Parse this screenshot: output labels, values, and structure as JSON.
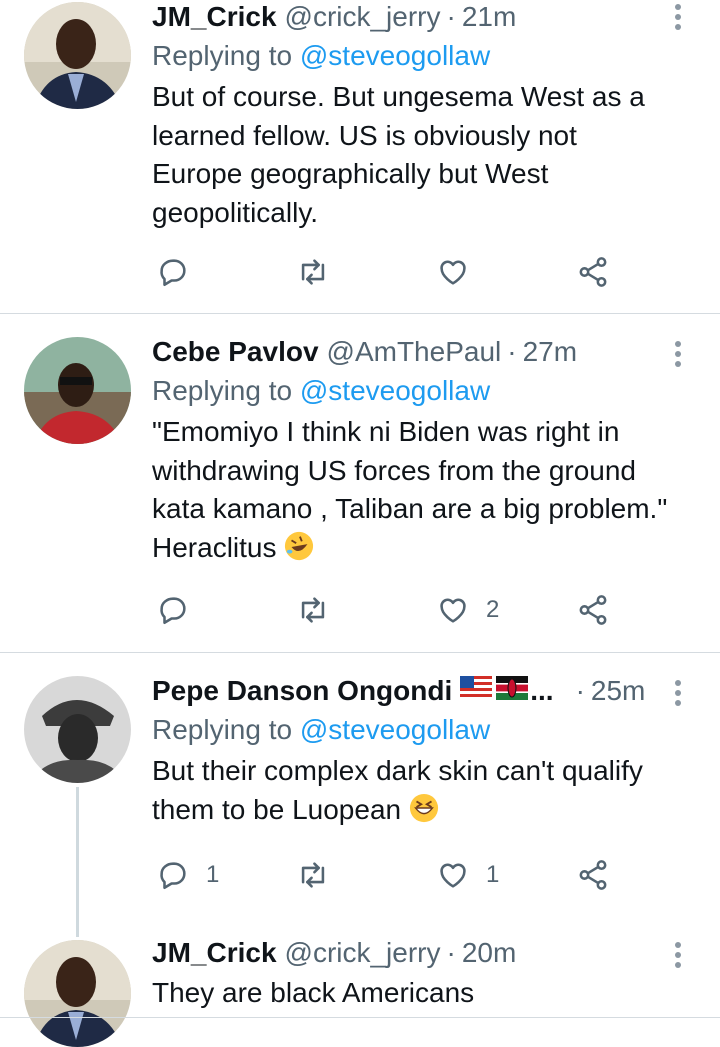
{
  "colors": {
    "accent": "#1d9bf0",
    "text": "#0f1419",
    "muted": "#536471",
    "divider": "#d5dbe0"
  },
  "tweets": [
    {
      "name": "JM_Crick",
      "handle": "@crick_jerry",
      "dot": "·",
      "time": "21m",
      "reply_prefix": "Replying to",
      "reply_to": "@steveogollaw",
      "lines": [
        "But of course. But ungesema West as a",
        "learned fellow. US is obviously not",
        "Europe geographically but West",
        "geopolitically."
      ],
      "reply_count": "",
      "retweet_count": "",
      "like_count": ""
    },
    {
      "name": "Cebe Pavlov",
      "handle": "@AmThePaul",
      "dot": "·",
      "time": "27m",
      "reply_prefix": "Replying to",
      "reply_to": "@steveogollaw",
      "lines": [
        "\"Emomiyo I think ni Biden was right in",
        "withdrawing US forces from the ground",
        "kata kamano , Taliban are a big problem.\"",
        "Heraclitus"
      ],
      "emoji": "rolling-on-floor-laughing",
      "reply_count": "",
      "retweet_count": "",
      "like_count": "2"
    },
    {
      "name": "Pepe Danson Ongondi",
      "flags": [
        "us-flag",
        "kenya-flag"
      ],
      "ellipsis": "...",
      "dot": "·",
      "time": "25m",
      "reply_prefix": "Replying to",
      "reply_to": "@steveogollaw",
      "lines": [
        "But their complex dark skin can't qualify",
        "them to be Luopean"
      ],
      "emoji": "grinning-squinting",
      "reply_count": "1",
      "retweet_count": "",
      "like_count": "1"
    },
    {
      "name": "JM_Crick",
      "handle": "@crick_jerry",
      "dot": "·",
      "time": "20m",
      "lines": [
        "They are black Americans"
      ]
    }
  ],
  "icons": {
    "reply": "reply-icon",
    "retweet": "retweet-icon",
    "like": "like-icon",
    "share": "share-icon",
    "more": "more-icon"
  }
}
